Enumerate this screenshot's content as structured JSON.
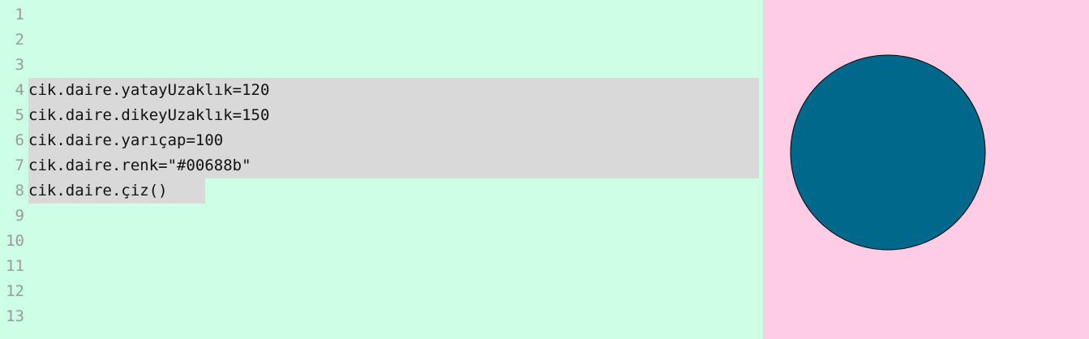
{
  "editor": {
    "lines": [
      {
        "number": "1",
        "code": ""
      },
      {
        "number": "2",
        "code": ""
      },
      {
        "number": "3",
        "code": ""
      },
      {
        "number": "4",
        "code": "cik.daire.yatayUzaklık=120"
      },
      {
        "number": "5",
        "code": "cik.daire.dikeyUzaklık=150"
      },
      {
        "number": "6",
        "code": "cik.daire.yarıçap=100"
      },
      {
        "number": "7",
        "code": "cik.daire.renk=\"#00688b\""
      },
      {
        "number": "8",
        "code": "cik.daire.çiz()"
      },
      {
        "number": "9",
        "code": ""
      },
      {
        "number": "10",
        "code": ""
      },
      {
        "number": "11",
        "code": ""
      },
      {
        "number": "12",
        "code": ""
      },
      {
        "number": "13",
        "code": ""
      }
    ]
  },
  "canvas": {
    "circle": {
      "fill": "#00688b",
      "stroke": "#000000"
    }
  },
  "colors": {
    "editor_bg": "#ccffe6",
    "canvas_bg": "#ffcce6",
    "selection": "#d9d9d9",
    "gutter_text": "#9a9a9a"
  }
}
